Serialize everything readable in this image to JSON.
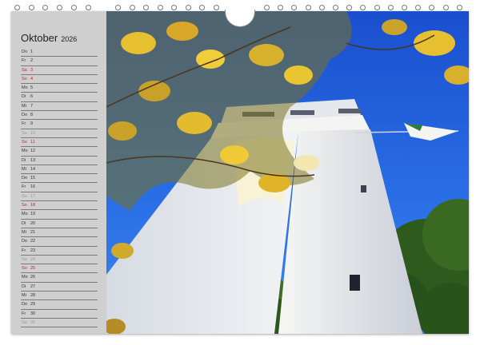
{
  "calendar": {
    "month": "Oktober",
    "year": "2026",
    "days": [
      {
        "wd": "Do",
        "d": "1",
        "type": "weekday"
      },
      {
        "wd": "Fr",
        "d": "2",
        "type": "weekday"
      },
      {
        "wd": "Sa",
        "d": "3",
        "type": "sunday"
      },
      {
        "wd": "So",
        "d": "4",
        "type": "sunday"
      },
      {
        "wd": "Mo",
        "d": "5",
        "type": "weekday"
      },
      {
        "wd": "Di",
        "d": "6",
        "type": "weekday"
      },
      {
        "wd": "Mi",
        "d": "7",
        "type": "weekday"
      },
      {
        "wd": "Do",
        "d": "8",
        "type": "weekday"
      },
      {
        "wd": "Fr",
        "d": "9",
        "type": "weekday"
      },
      {
        "wd": "Sa",
        "d": "10",
        "type": "saturday"
      },
      {
        "wd": "So",
        "d": "11",
        "type": "sunday"
      },
      {
        "wd": "Mo",
        "d": "12",
        "type": "weekday"
      },
      {
        "wd": "Di",
        "d": "13",
        "type": "weekday"
      },
      {
        "wd": "Mi",
        "d": "14",
        "type": "weekday"
      },
      {
        "wd": "Do",
        "d": "15",
        "type": "weekday"
      },
      {
        "wd": "Fr",
        "d": "16",
        "type": "weekday"
      },
      {
        "wd": "Sa",
        "d": "17",
        "type": "saturday"
      },
      {
        "wd": "So",
        "d": "18",
        "type": "sunday"
      },
      {
        "wd": "Mo",
        "d": "19",
        "type": "weekday"
      },
      {
        "wd": "Di",
        "d": "20",
        "type": "weekday"
      },
      {
        "wd": "Mi",
        "d": "21",
        "type": "weekday"
      },
      {
        "wd": "Do",
        "d": "22",
        "type": "weekday"
      },
      {
        "wd": "Fr",
        "d": "23",
        "type": "weekday"
      },
      {
        "wd": "Sa",
        "d": "24",
        "type": "saturday"
      },
      {
        "wd": "So",
        "d": "25",
        "type": "sunday"
      },
      {
        "wd": "Mo",
        "d": "26",
        "type": "weekday"
      },
      {
        "wd": "Di",
        "d": "27",
        "type": "weekday"
      },
      {
        "wd": "Mi",
        "d": "28",
        "type": "weekday"
      },
      {
        "wd": "Do",
        "d": "29",
        "type": "weekday"
      },
      {
        "wd": "Fr",
        "d": "30",
        "type": "weekday"
      },
      {
        "wd": "Sa",
        "d": "31",
        "type": "saturday"
      }
    ]
  },
  "colors": {
    "sidebar": "#cfcfcf",
    "sunday_red": "#d21e1e",
    "sky": "#1e5fd6",
    "tower": "#eef0f2",
    "leaves": "#e0b428"
  }
}
